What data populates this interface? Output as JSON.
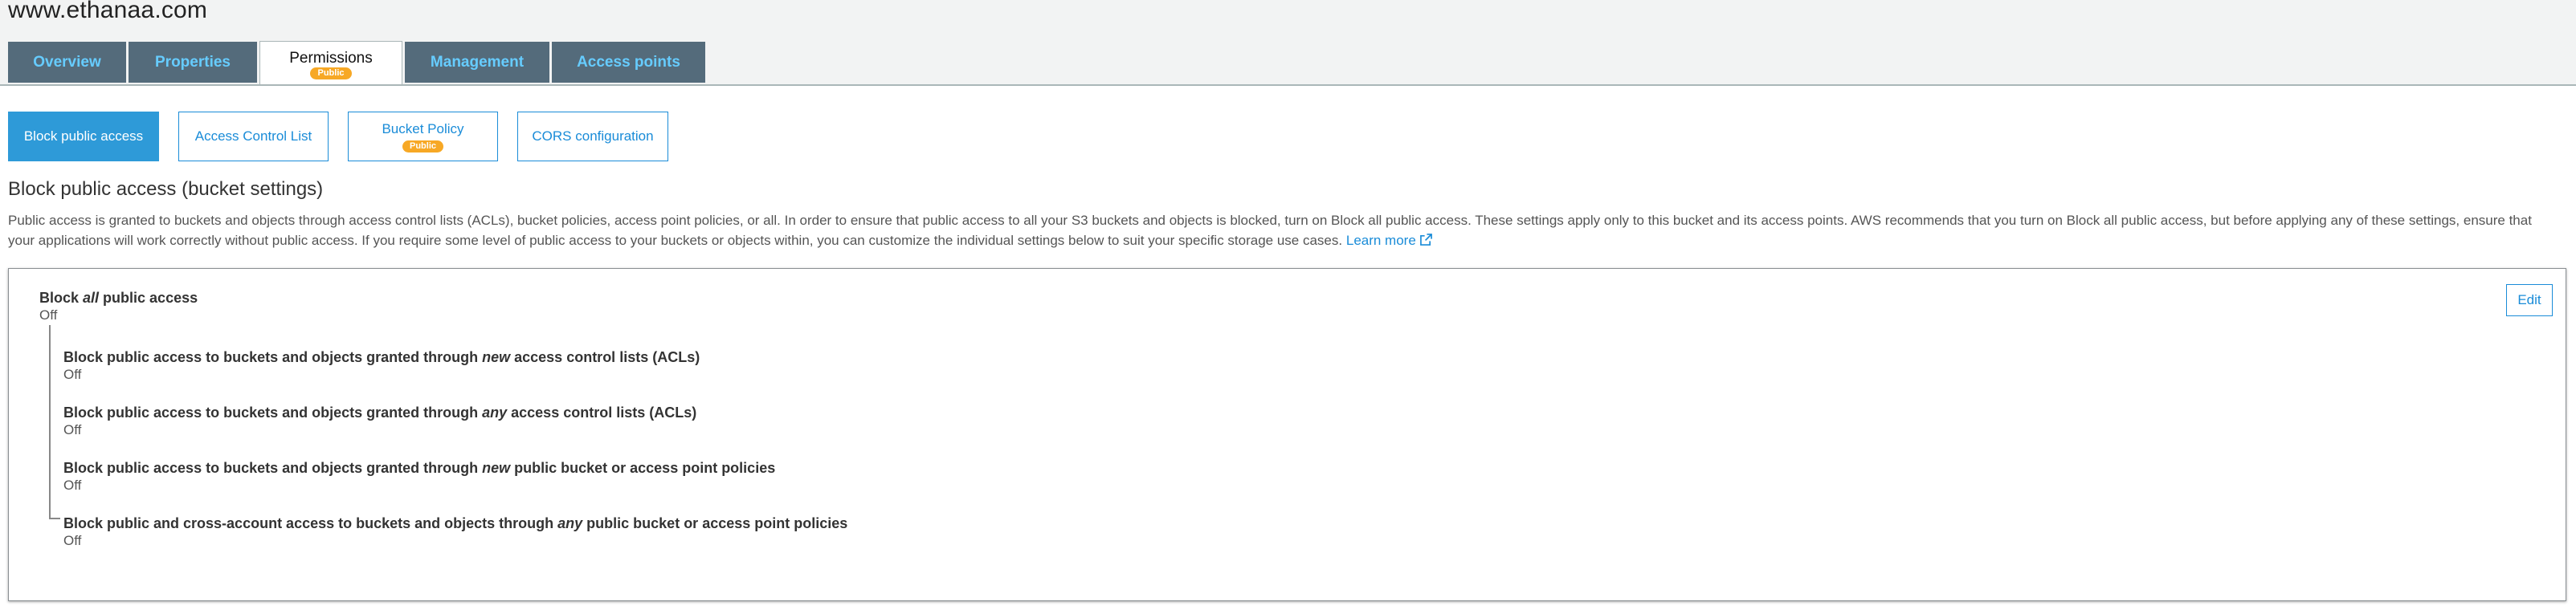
{
  "site": {
    "title": "www.ethanaa.com"
  },
  "tabs": [
    {
      "label": "Overview"
    },
    {
      "label": "Properties"
    },
    {
      "label": "Permissions",
      "badge": "Public"
    },
    {
      "label": "Management"
    },
    {
      "label": "Access points"
    }
  ],
  "subtabs": [
    {
      "label": "Block public access"
    },
    {
      "label": "Access Control List"
    },
    {
      "label": "Bucket Policy",
      "badge": "Public"
    },
    {
      "label": "CORS configuration"
    }
  ],
  "section": {
    "title": "Block public access (bucket settings)",
    "description": "Public access is granted to buckets and objects through access control lists (ACLs), bucket policies, access point policies, or all. In order to ensure that public access to all your S3 buckets and objects is blocked, turn on Block all public access. These settings apply only to this bucket and its access points. AWS recommends that you turn on Block all public access, but before applying any of these settings, ensure that your applications will work correctly without public access. If you require some level of public access to your buckets or objects within, you can customize the individual settings below to suit your specific storage use cases.",
    "learn_more": "Learn more"
  },
  "panel": {
    "edit_label": "Edit",
    "main": {
      "pre": "Block ",
      "em": "all",
      "post": " public access",
      "value": "Off"
    },
    "settings": [
      {
        "pre": "Block public access to buckets and objects granted through ",
        "em": "new",
        "post": " access control lists (ACLs)",
        "value": "Off"
      },
      {
        "pre": "Block public access to buckets and objects granted through ",
        "em": "any",
        "post": " access control lists (ACLs)",
        "value": "Off"
      },
      {
        "pre": "Block public access to buckets and objects granted through ",
        "em": "new",
        "post": " public bucket or access point policies",
        "value": "Off"
      },
      {
        "pre": "Block public and cross-account access to buckets and objects through ",
        "em": "any",
        "post": " public bucket or access point policies",
        "value": "Off"
      }
    ]
  },
  "colors": {
    "tab_bg": "#546b7b",
    "tab_text": "#66ccff",
    "accent": "#1a8cd8",
    "badge": "#f7a825"
  },
  "icons": {
    "external_link": "external-link-icon"
  }
}
